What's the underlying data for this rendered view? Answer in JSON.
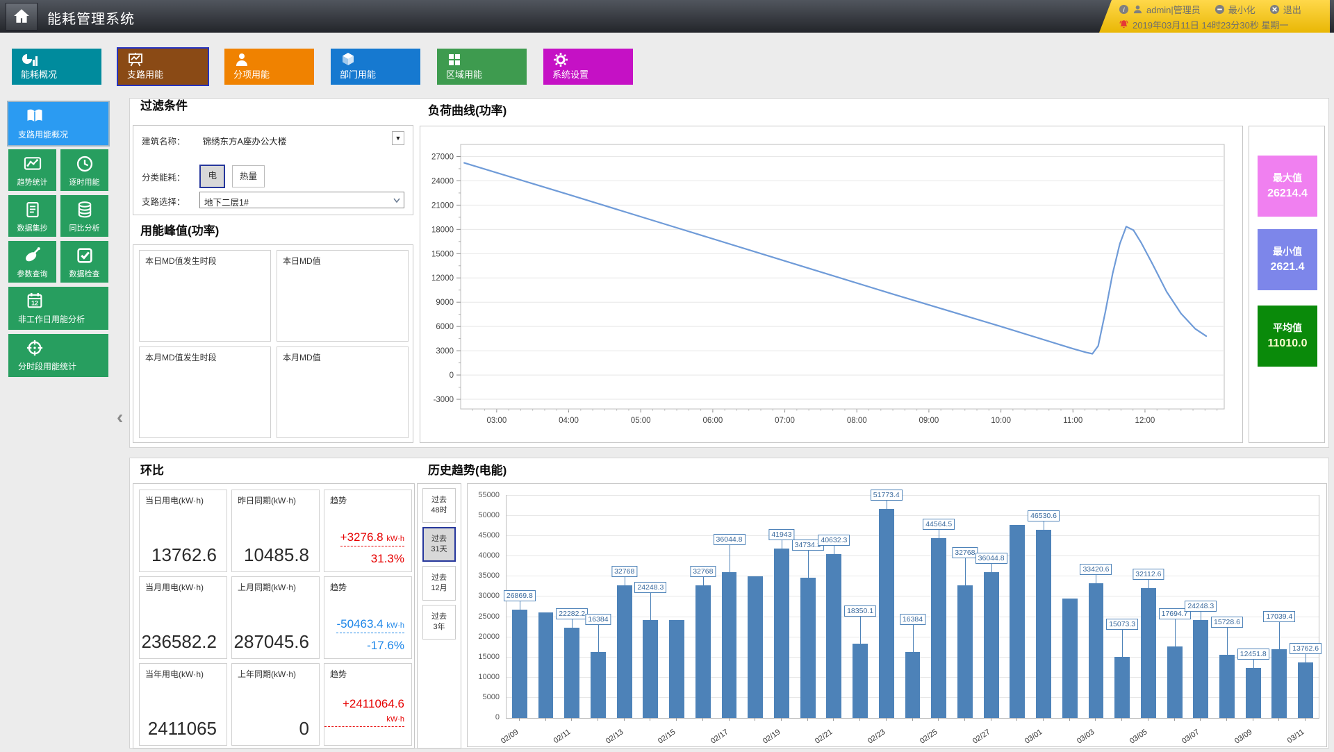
{
  "header": {
    "title": "能耗管理系统",
    "user": "admin|管理员",
    "minimize_label": "最小化",
    "logout_label": "退出",
    "datetime": "2019年03月11日 14时23分30秒 星期一"
  },
  "nav_tabs": [
    {
      "name": "energy-overview",
      "label": "能耗概况",
      "icon": "pie-bars-icon",
      "color": "#008b9d",
      "selected": false
    },
    {
      "name": "branch-energy",
      "label": "支路用能",
      "icon": "presentation-chart-icon",
      "color": "#8a4a15",
      "selected": true
    },
    {
      "name": "subitem-energy",
      "label": "分项用能",
      "icon": "person-icon",
      "color": "#f08200",
      "selected": false
    },
    {
      "name": "department-energy",
      "label": "部门用能",
      "icon": "cube-icon",
      "color": "#1679d0",
      "selected": false
    },
    {
      "name": "area-energy",
      "label": "区域用能",
      "icon": "grid-icon",
      "color": "#3e9b4f",
      "selected": false
    },
    {
      "name": "system-settings",
      "label": "系统设置",
      "icon": "gear-icon",
      "color": "#c511c5",
      "selected": false
    }
  ],
  "sidebar": {
    "items": [
      {
        "name": "branch-overview",
        "label": "支路用能概况",
        "icon": "open-book-icon",
        "selected": true,
        "full": true
      },
      {
        "name": "trend-stats",
        "label": "趋势统计",
        "icon": "trend-chart-icon",
        "selected": false,
        "full": false
      },
      {
        "name": "hourly-energy",
        "label": "逐时用能",
        "icon": "clock-icon",
        "selected": false,
        "full": false
      },
      {
        "name": "data-collection",
        "label": "数据集抄",
        "icon": "document-icon",
        "selected": false,
        "full": false
      },
      {
        "name": "yoy-analysis",
        "label": "同比分析",
        "icon": "database-icon",
        "selected": false,
        "full": false
      },
      {
        "name": "parameter-query",
        "label": "参数查询",
        "icon": "satellite-dish-icon",
        "selected": false,
        "full": false
      },
      {
        "name": "data-check",
        "label": "数据检查",
        "icon": "check-box-icon",
        "selected": false,
        "full": false
      },
      {
        "name": "non-workday-analysis",
        "label": "非工作日用能分析",
        "icon": "calendar-icon",
        "selected": false,
        "full": true
      },
      {
        "name": "time-period-stats",
        "label": "分时段用能统计",
        "icon": "crosshair-icon",
        "selected": false,
        "full": true
      }
    ]
  },
  "filter": {
    "title": "过滤条件",
    "building_label": "建筑名称：",
    "building_value": "锦绣东方A座办公大楼",
    "energy_label": "分类能耗：",
    "energy_options": [
      "电",
      "热量"
    ],
    "energy_selected": "电",
    "branch_label": "支路选择：",
    "branch_value": "地下二层1#"
  },
  "peak": {
    "title": "用能峰值(功率)",
    "cells": [
      "本日MD值发生时段",
      "本日MD值",
      "本月MD值发生时段",
      "本月MD值"
    ]
  },
  "load": {
    "title": "负荷曲线(功率)",
    "stats": [
      {
        "label": "最大值",
        "value": "26214.4",
        "color": "#f080f0"
      },
      {
        "label": "最小值",
        "value": "2621.4",
        "color": "#7d86ea"
      },
      {
        "label": "平均值",
        "value": "11010.0",
        "color": "#0a8a0a"
      }
    ]
  },
  "huanbi": {
    "title": "环比",
    "rows": [
      [
        {
          "label": "当日用电(kW·h)",
          "value": "13762.6"
        },
        {
          "label": "昨日同期(kW·h)",
          "value": "10485.8"
        },
        {
          "label": "趋势",
          "delta": "+3276.8",
          "unit": "kW·h",
          "percent": "31.3%",
          "color": "#e60000"
        }
      ],
      [
        {
          "label": "当月用电(kW·h)",
          "value": "236582.2"
        },
        {
          "label": "上月同期(kW·h)",
          "value": "287045.6"
        },
        {
          "label": "趋势",
          "delta": "-50463.4",
          "unit": "kW·h",
          "percent": "-17.6%",
          "color": "#1d86e8"
        }
      ],
      [
        {
          "label": "当年用电(kW·h)",
          "value": "2411065"
        },
        {
          "label": "上年同期(kW·h)",
          "value": "0"
        },
        {
          "label": "趋势",
          "delta": "+2411064.6",
          "unit": "kW·h",
          "percent": "",
          "color": "#e60000"
        }
      ]
    ]
  },
  "history": {
    "title": "历史趋势(电能)",
    "tabs": [
      "过去48时",
      "过去31天",
      "过去12月",
      "过去3年"
    ],
    "selected_tab": "过去31天"
  },
  "chart_data": [
    {
      "type": "line",
      "title": "负荷曲线(功率)",
      "line_color": "#6f9bd8",
      "ylim": [
        -3000,
        27000
      ],
      "ytick_step": 3000,
      "xtick_hours": [
        3,
        4,
        5,
        6,
        7,
        8,
        9,
        10,
        11,
        12
      ],
      "xtick_labels": [
        "03:00",
        "04:00",
        "05:00",
        "06:00",
        "07:00",
        "08:00",
        "09:00",
        "10:00",
        "11:00",
        "12:00"
      ],
      "grid": true,
      "points": [
        [
          2.55,
          26214.4
        ],
        [
          4.0,
          22300
        ],
        [
          5.5,
          18200
        ],
        [
          7.0,
          14100
        ],
        [
          8.5,
          10000
        ],
        [
          10.0,
          6000
        ],
        [
          11.0,
          3250
        ],
        [
          11.18,
          2800
        ],
        [
          11.27,
          2621.4
        ],
        [
          11.35,
          3600
        ],
        [
          11.45,
          7800
        ],
        [
          11.55,
          12500
        ],
        [
          11.65,
          16200
        ],
        [
          11.74,
          18350
        ],
        [
          11.84,
          17900
        ],
        [
          11.95,
          16300
        ],
        [
          12.1,
          13800
        ],
        [
          12.3,
          10300
        ],
        [
          12.5,
          7600
        ],
        [
          12.7,
          5700
        ],
        [
          12.85,
          4800
        ]
      ],
      "stats": {
        "max": 26214.4,
        "min": 2621.4,
        "avg": 11010.0
      }
    },
    {
      "type": "bar",
      "title": "历史趋势(电能)",
      "bar_color": "#4d82b8",
      "ylim": [
        0,
        55000
      ],
      "ytick_step": 5000,
      "xtick_every": 2,
      "categories": [
        "02/09",
        "02/10",
        "02/11",
        "02/12",
        "02/13",
        "02/14",
        "02/15",
        "02/16",
        "02/17",
        "02/18",
        "02/19",
        "02/20",
        "02/21",
        "02/22",
        "02/23",
        "02/24",
        "02/25",
        "02/26",
        "02/27",
        "02/28",
        "03/01",
        "03/02",
        "03/03",
        "03/04",
        "03/05",
        "03/06",
        "03/07",
        "03/08",
        "03/09",
        "03/10",
        "03/11"
      ],
      "values": [
        26869.8,
        26200,
        22282.2,
        16384,
        32768,
        24248.3,
        24300,
        32768,
        36044.8,
        35000,
        41943,
        34734.1,
        40632.3,
        18350.1,
        51773.4,
        16384,
        44564.5,
        32768,
        36044.8,
        47700,
        46530.6,
        29500,
        33420.6,
        15073.3,
        32112.6,
        17694.7,
        24248.3,
        15728.6,
        12451.8,
        17039.4,
        13762.6
      ],
      "labeled": [
        1,
        0,
        1,
        1,
        1,
        1,
        0,
        1,
        1,
        0,
        1,
        1,
        1,
        1,
        1,
        1,
        1,
        1,
        1,
        0,
        1,
        0,
        1,
        1,
        1,
        1,
        1,
        1,
        1,
        1,
        1
      ]
    }
  ]
}
